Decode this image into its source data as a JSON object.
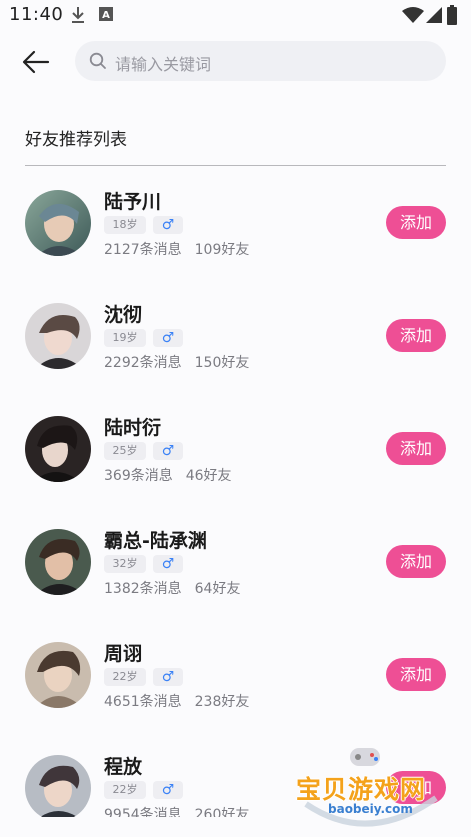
{
  "status_bar": {
    "time": "11:40",
    "icons": [
      "download-icon",
      "a-box-icon",
      "wifi-icon",
      "signal-icon",
      "battery-icon"
    ]
  },
  "header": {
    "back_icon": "back-arrow-icon",
    "search_icon": "search-icon",
    "search_placeholder": "请输入关键词"
  },
  "section_title": "好友推荐列表",
  "friends": [
    {
      "name": "陆予川",
      "age": "18岁",
      "gender": "♂",
      "messages": "2127条消息",
      "friends": "109好友",
      "add_label": "添加"
    },
    {
      "name": "沈彻",
      "age": "19岁",
      "gender": "♂",
      "messages": "2292条消息",
      "friends": "150好友",
      "add_label": "添加"
    },
    {
      "name": "陆时衍",
      "age": "25岁",
      "gender": "♂",
      "messages": "369条消息",
      "friends": "46好友",
      "add_label": "添加"
    },
    {
      "name": "霸总-陆承渊",
      "age": "32岁",
      "gender": "♂",
      "messages": "1382条消息",
      "friends": "64好友",
      "add_label": "添加"
    },
    {
      "name": "周诩",
      "age": "22岁",
      "gender": "♂",
      "messages": "4651条消息",
      "friends": "238好友",
      "add_label": "添加"
    },
    {
      "name": "程放",
      "age": "22岁",
      "gender": "♂",
      "messages": "9954条消息",
      "friends": "260好友",
      "add_label": "添加"
    }
  ],
  "colors": {
    "accent": "#ee4f95",
    "gender_male": "#3b82f6",
    "search_bg": "#eff0f4"
  },
  "watermark": {
    "title": "宝贝游戏网",
    "domain": "baobeiy.com"
  }
}
